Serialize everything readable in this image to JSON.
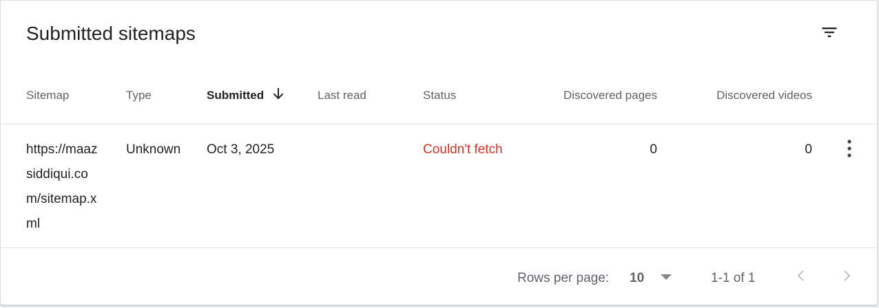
{
  "card": {
    "title": "Submitted sitemaps",
    "filter_icon": "filter-list-icon"
  },
  "table": {
    "columns": [
      {
        "label": "Sitemap"
      },
      {
        "label": "Type"
      },
      {
        "label": "Submitted",
        "sorted": "descending",
        "sort_icon": "arrow-down-icon"
      },
      {
        "label": "Last read"
      },
      {
        "label": "Status"
      },
      {
        "label": "Discovered pages"
      },
      {
        "label": "Discovered videos"
      }
    ],
    "rows": [
      {
        "sitemap": "https://maazsiddiqui.com/sitemap.xml",
        "type": "Unknown",
        "submitted": "Oct 3, 2025",
        "last_read": "",
        "status": "Couldn't fetch",
        "discovered_pages": "0",
        "discovered_videos": "0",
        "more_icon": "more-vert-icon"
      }
    ]
  },
  "footer": {
    "rows_per_page_label": "Rows per page:",
    "rows_per_page_value": "10",
    "range": "1-1 of 1",
    "prev_icon": "chevron-left-icon",
    "next_icon": "chevron-right-icon"
  },
  "colors": {
    "status_error": "#d93025",
    "header_text": "#5f6368",
    "body_text": "#202124",
    "divider": "#e0e0e0"
  }
}
